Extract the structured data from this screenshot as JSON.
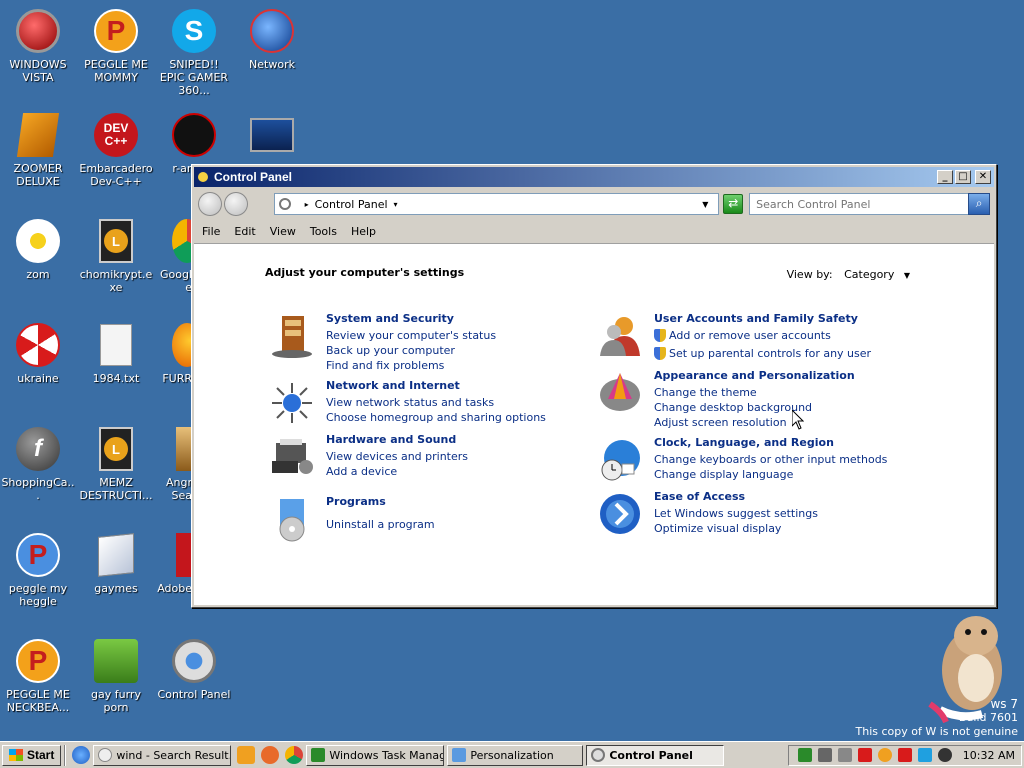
{
  "desktop": {
    "icons": [
      {
        "label": "WINDOWS VISTA",
        "icon": "vista-orb-icon"
      },
      {
        "label": "PEGGLE ME MOMMY",
        "icon": "peggle-icon"
      },
      {
        "label": "SNIPED!! EPIC GAMER 360...",
        "icon": "skype-icon"
      },
      {
        "label": "Network",
        "icon": "network-icon"
      },
      {
        "label": "ZOOMER DELUXE",
        "icon": "zoomer-icon"
      },
      {
        "label": "Embarcadero Dev-C++",
        "icon": "devcpp-icon"
      },
      {
        "label": "r-an par",
        "icon": "app-icon"
      },
      {
        "label": "zom",
        "icon": "flower-icon"
      },
      {
        "label": "chomikrypt.exe",
        "icon": "lock-file-icon"
      },
      {
        "label": "Google",
        "icon": "chrome-icon"
      },
      {
        "label": "ukraine",
        "icon": "radiation-icon"
      },
      {
        "label": "1984.txt",
        "icon": "text-file-icon"
      },
      {
        "label": "FURR",
        "icon": "firefox-icon"
      },
      {
        "label": "ShoppingCa...",
        "icon": "flash-icon"
      },
      {
        "label": "MEMZ DESTRUCTI...",
        "icon": "lock-file-icon"
      },
      {
        "label": "Angr Sea",
        "icon": "game-icon"
      },
      {
        "label": "peggle my heggle",
        "icon": "peggle-icon"
      },
      {
        "label": "gaymes",
        "icon": "folder-icon"
      },
      {
        "label": "Adobe",
        "icon": "adobe-icon"
      },
      {
        "label": "PEGGLE ME NECKBEA...",
        "icon": "peggle-icon"
      },
      {
        "label": "gay furry porn",
        "icon": "box-icon"
      },
      {
        "label": "Control Panel",
        "icon": "control-panel-icon"
      }
    ]
  },
  "window": {
    "title": "Control Panel",
    "address": "Control Panel",
    "search_placeholder": "Search Control Panel",
    "menu": [
      "File",
      "Edit",
      "View",
      "Tools",
      "Help"
    ],
    "heading": "Adjust your computer's settings",
    "view_by_label": "View by:",
    "view_by_value": "Category",
    "categories": [
      {
        "title": "System and Security",
        "links": [
          "Review your computer's status",
          "Back up your computer",
          "Find and fix problems"
        ]
      },
      {
        "title": "Network and Internet",
        "links": [
          "View network status and tasks",
          "Choose homegroup and sharing options"
        ]
      },
      {
        "title": "Hardware and Sound",
        "links": [
          "View devices and printers",
          "Add a device"
        ]
      },
      {
        "title": "Programs",
        "links": [
          "Uninstall a program"
        ]
      },
      {
        "title": "User Accounts and Family Safety",
        "links": [
          "Add or remove user accounts",
          "Set up parental controls for any user"
        ]
      },
      {
        "title": "Appearance and Personalization",
        "links": [
          "Change the theme",
          "Change desktop background",
          "Adjust screen resolution"
        ]
      },
      {
        "title": "Clock, Language, and Region",
        "links": [
          "Change keyboards or other input methods",
          "Change display language"
        ]
      },
      {
        "title": "Ease of Access",
        "links": [
          "Let Windows suggest settings",
          "Optimize visual display"
        ]
      }
    ]
  },
  "taskbar": {
    "start_label": "Start",
    "tasks": [
      "wind - Search Result...",
      "Windows Task Manager",
      "Personalization",
      "Control Panel"
    ],
    "clock": "10:32 AM"
  },
  "watermark": {
    "line1": "ws 7",
    "line2": "Build 7601",
    "line3": "This copy of W       is not genuine"
  },
  "colors": {
    "desktop": "#3a6ea5",
    "link": "#0b2f86",
    "titlebar_start": "#0a246a"
  }
}
